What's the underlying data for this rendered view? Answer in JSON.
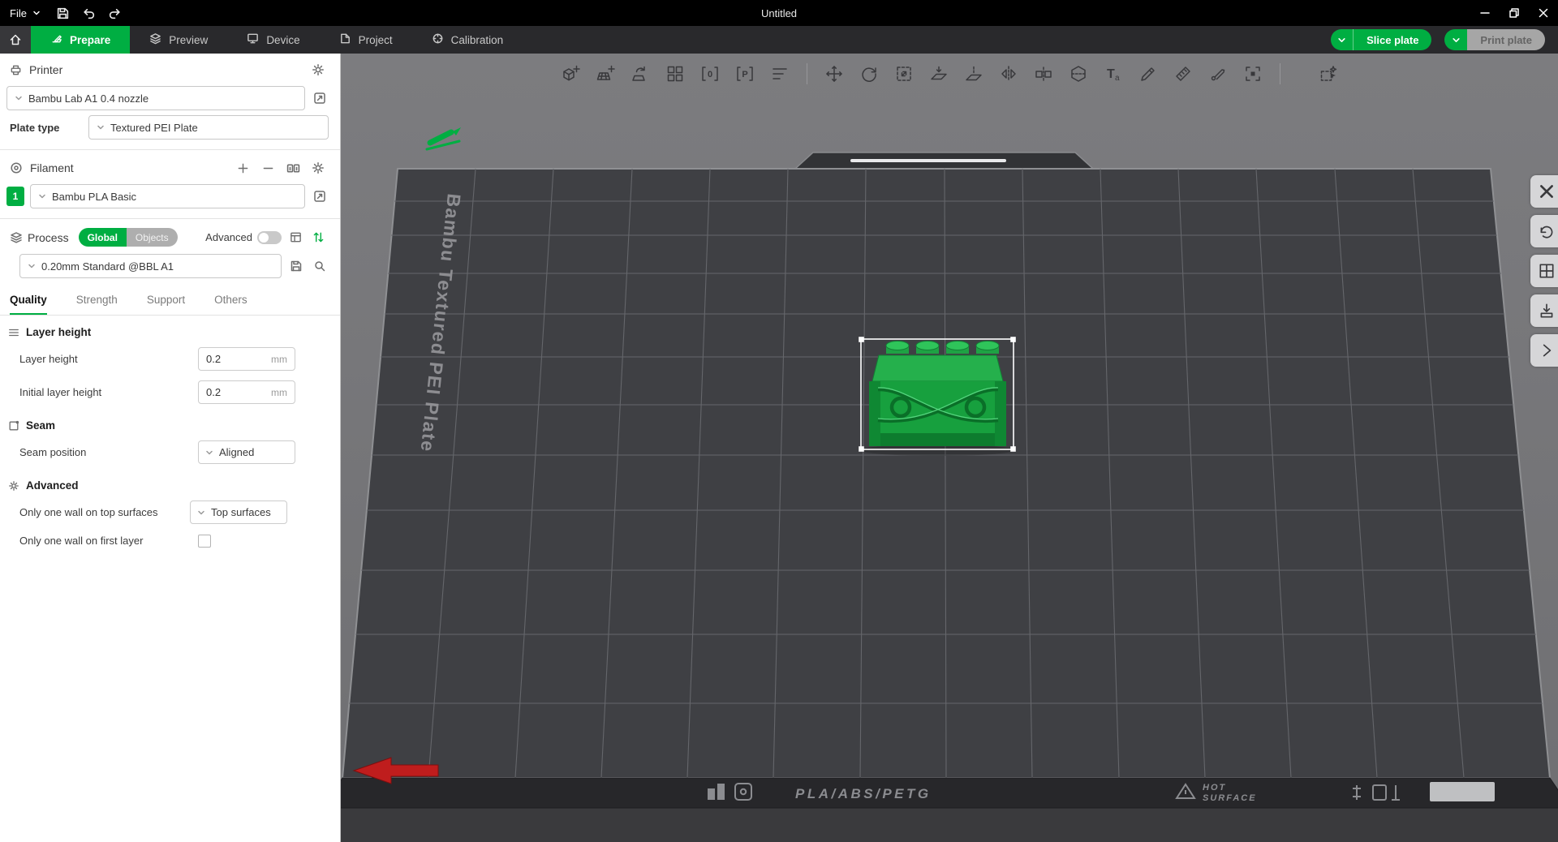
{
  "titlebar": {
    "file_menu": "File",
    "title": "Untitled"
  },
  "tabbar": {
    "tabs": [
      {
        "label": "Prepare"
      },
      {
        "label": "Preview"
      },
      {
        "label": "Device"
      },
      {
        "label": "Project"
      },
      {
        "label": "Calibration"
      }
    ],
    "slice_button": "Slice plate",
    "print_button": "Print plate"
  },
  "sidebar": {
    "printer": {
      "title": "Printer",
      "preset": "Bambu Lab A1 0.4 nozzle",
      "plate_type_label": "Plate type",
      "plate_type": "Textured PEI Plate"
    },
    "filament": {
      "title": "Filament",
      "slot_number": "1",
      "preset": "Bambu PLA Basic"
    },
    "process": {
      "title": "Process",
      "scope_global": "Global",
      "scope_objects": "Objects",
      "advanced_label": "Advanced",
      "preset": "0.20mm Standard @BBL A1",
      "tabs": [
        "Quality",
        "Strength",
        "Support",
        "Others"
      ]
    },
    "quality": {
      "groups": [
        {
          "title": "Layer height"
        },
        {
          "title": "Seam"
        },
        {
          "title": "Advanced"
        }
      ],
      "layer_height": {
        "label": "Layer height",
        "value": "0.2",
        "unit": "mm"
      },
      "initial_layer_height": {
        "label": "Initial layer height",
        "value": "0.2",
        "unit": "mm"
      },
      "seam_position": {
        "label": "Seam position",
        "value": "Aligned"
      },
      "one_wall_top": {
        "label": "Only one wall on top surfaces",
        "value": "Top surfaces"
      },
      "one_wall_first": {
        "label": "Only one wall on first layer"
      }
    }
  },
  "viewport": {
    "plate_name": "Bambu Textured PEI Plate",
    "skirt_text": "PLA/ABS/PETG",
    "hot_label_1": "HOT",
    "hot_label_2": "SURFACE",
    "toolbar_icons": [
      "add-object",
      "add-plate",
      "auto-orient",
      "arrange",
      "plate-counter",
      "plate-name",
      "plate-settings",
      "move",
      "rotate",
      "scale",
      "lay-on-face",
      "cut",
      "mirror",
      "split-to-objects",
      "split-to-parts",
      "text",
      "color-painting",
      "measure",
      "seam-painting",
      "assembly-view",
      "variable-layer-height"
    ]
  },
  "colors": {
    "accent_green": "#00ae42",
    "model_green": "#17a03e",
    "plate_dark": "#3f4044",
    "titlebar_black": "#000000"
  }
}
